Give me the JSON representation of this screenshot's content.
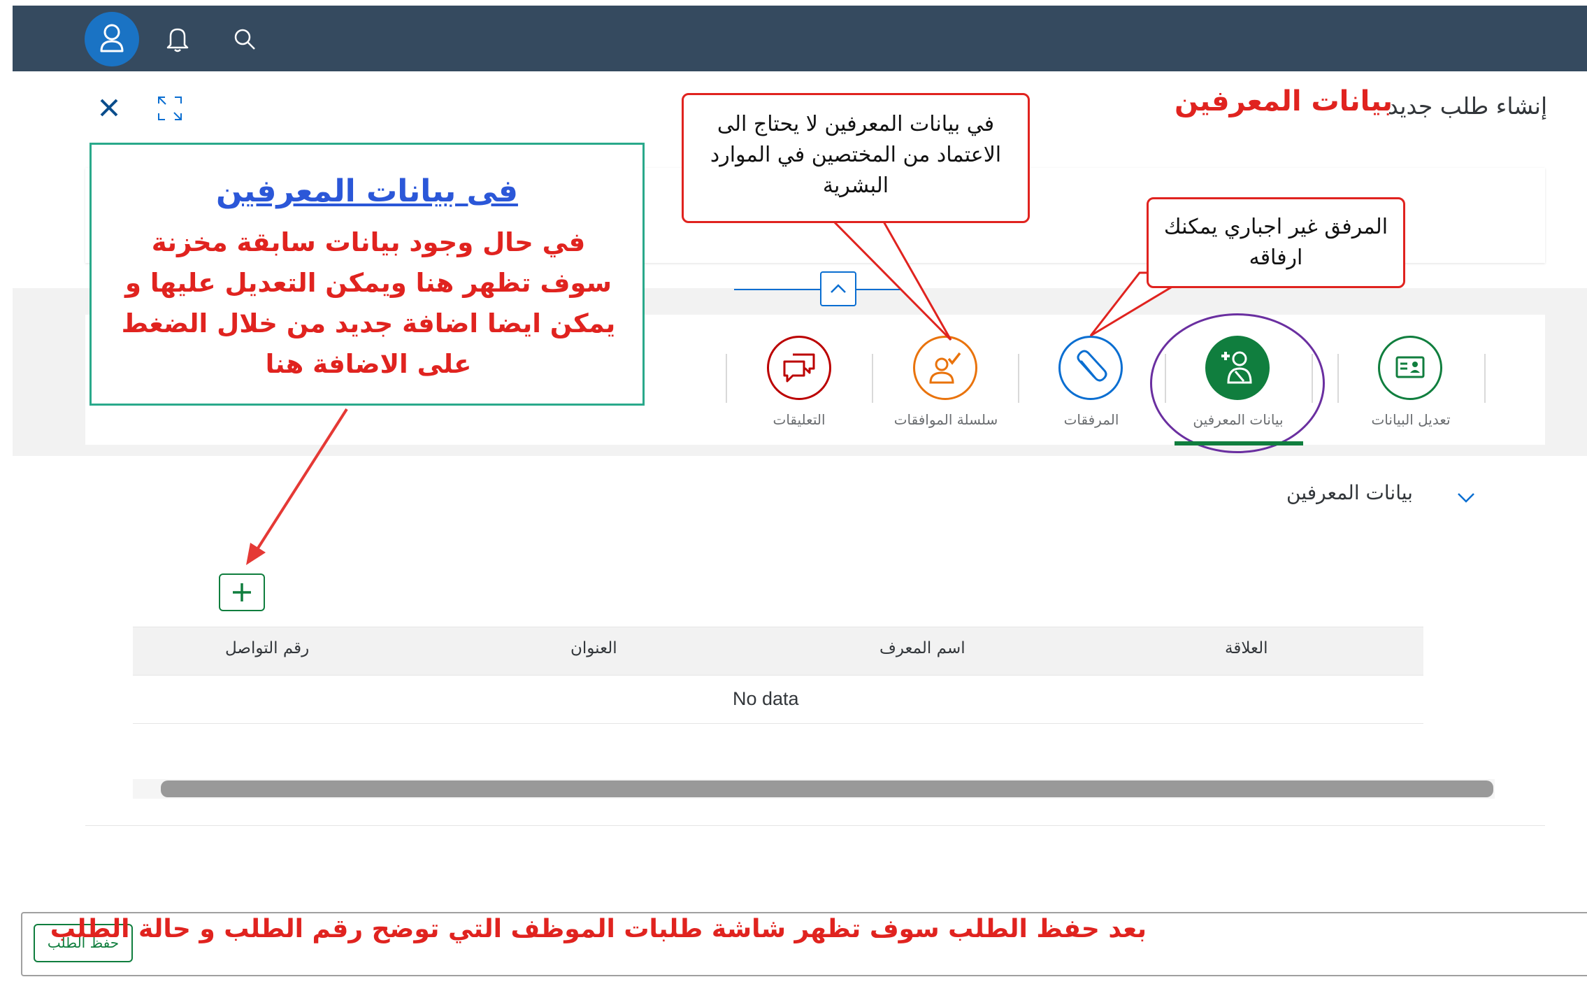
{
  "header": {
    "avatar_icon": "user-icon",
    "notification_icon": "bell-icon",
    "search_icon": "search-icon"
  },
  "page": {
    "title": "إنشاء طلب جديد",
    "annotation_title": "بيانات المعرفين",
    "close_icon": "close-icon",
    "fullscreen_icon": "fullscreen-icon"
  },
  "callouts": {
    "hr_approval": "في بيانات المعرفين لا يحتاج الى الاعتماد من المختصين في الموارد البشرية",
    "attachment_optional": "المرفق غير اجباري يمكنك ارفاقه",
    "referees_title": "فى بيانات المعرفين",
    "referees_body": "في حال وجود بيانات سابقة مخزنة سوف تظهر هنا ويمكن التعديل عليها و يمكن ايضا اضافة جديد من خلال الضغط على الاضافة هنا"
  },
  "tabs": [
    {
      "label": "تعديل البيانات",
      "icon": "id-card-icon",
      "color": "#107e3e"
    },
    {
      "label": "بيانات المعرفين",
      "icon": "add-person-icon",
      "color": "#107e3e",
      "active": true
    },
    {
      "label": "المرفقات",
      "icon": "paperclip-icon",
      "color": "#0a6ed1"
    },
    {
      "label": "سلسلة الموافقات",
      "icon": "person-check-icon",
      "color": "#e9730c"
    },
    {
      "label": "التعليقات",
      "icon": "comments-icon",
      "color": "#bb0000"
    }
  ],
  "section": {
    "title": "بيانات المعرفين",
    "toggle_icon": "chevron-down-icon"
  },
  "table": {
    "add_icon": "plus-icon",
    "columns": [
      "العلاقة",
      "اسم المعرف",
      "العنوان",
      "رقم التواصل"
    ],
    "empty_text": "No data"
  },
  "footer": {
    "save_label": "حفظ الطلب",
    "note": "بعد حفظ الطلب سوف تظهر شاشة طلبات الموظف  التي توضح رقم الطلب و حالة الطلب"
  }
}
